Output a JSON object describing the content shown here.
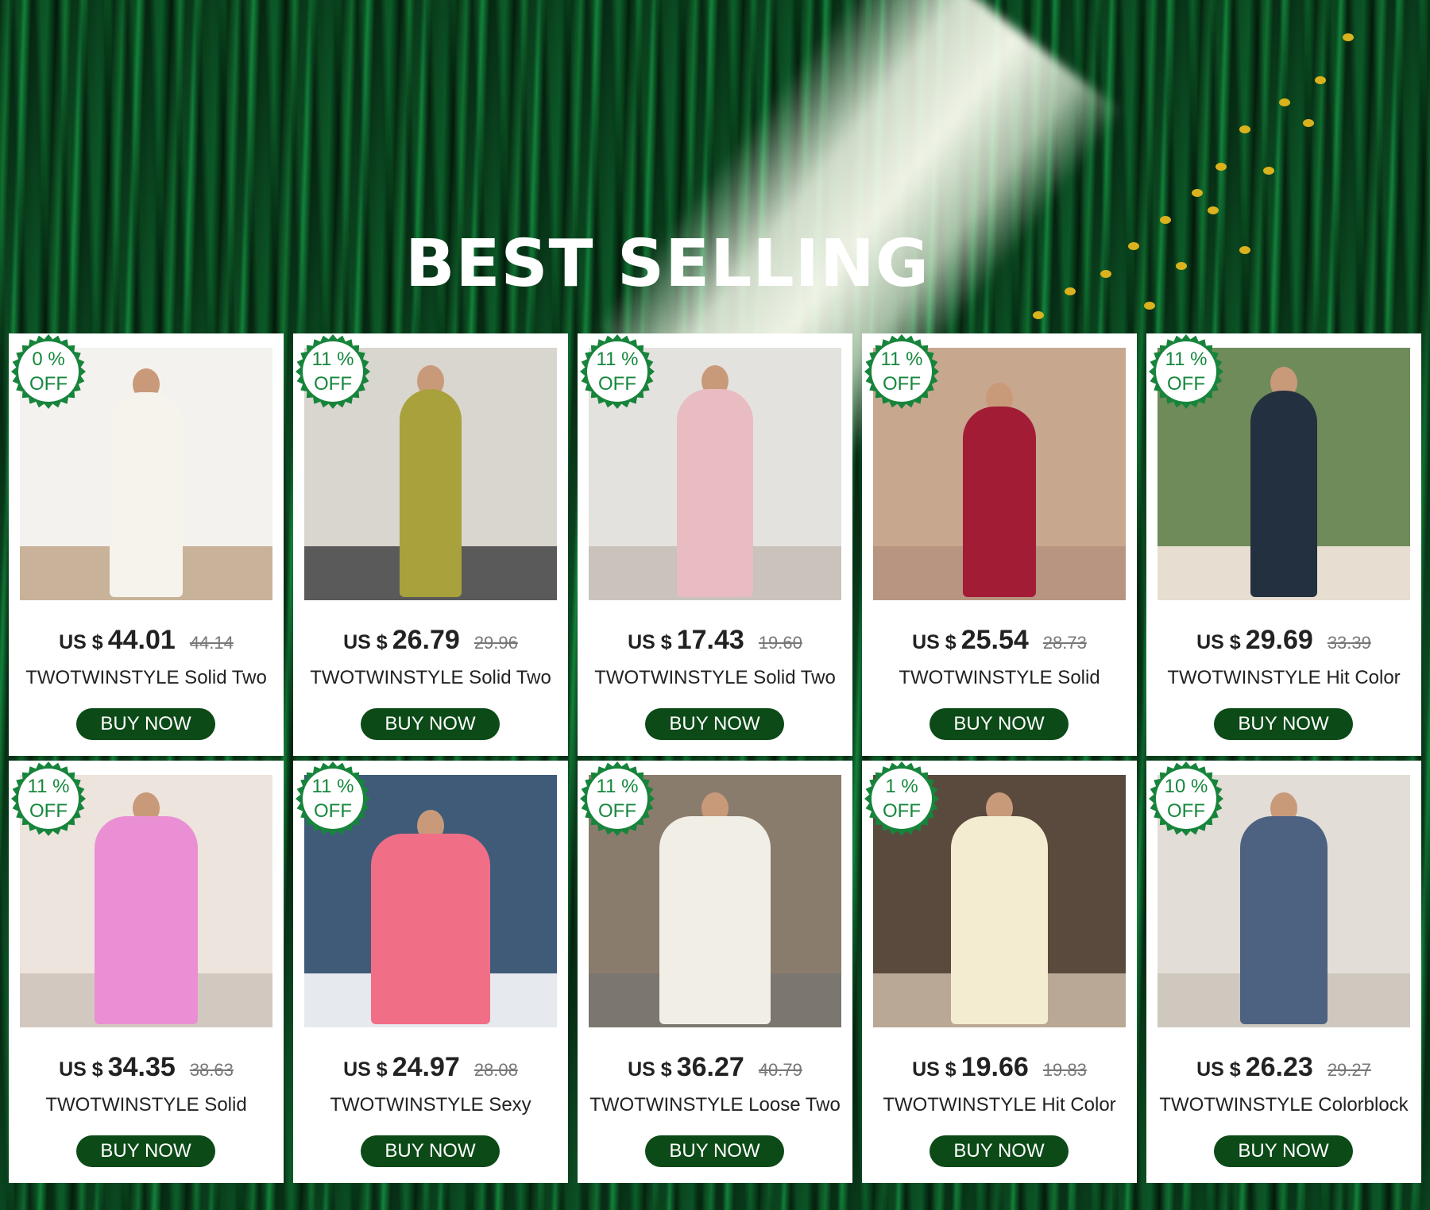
{
  "banner": {
    "title": "BEST SELLING"
  },
  "product_labels": {
    "currency": "US $",
    "off": "OFF",
    "buy": "BUY NOW"
  },
  "products": [
    {
      "discount": "0 %",
      "price": "44.01",
      "old_price": "44.14",
      "name": "TWOTWINSTYLE Solid Two",
      "bg": "#f4f2ee",
      "floor": "#c8b39a",
      "outfit": "#f6f3ec",
      "fig_w": 92,
      "fig_h": 258
    },
    {
      "discount": "11 %",
      "price": "26.79",
      "old_price": "29.96",
      "name": "TWOTWINSTYLE Solid Two",
      "bg": "#d9d5cf",
      "floor": "#5a5a5a",
      "outfit": "#a8a13c",
      "fig_w": 78,
      "fig_h": 262
    },
    {
      "discount": "11 %",
      "price": "17.43",
      "old_price": "19.60",
      "name": "TWOTWINSTYLE Solid Two",
      "bg": "#e4e2df",
      "floor": "#c9c3bc",
      "outfit": "#e8bcc0",
      "fig_w": 96,
      "fig_h": 262
    },
    {
      "discount": "11 %",
      "price": "25.54",
      "old_price": "28.73",
      "name": "TWOTWINSTYLE Solid",
      "bg": "#c8a78f",
      "floor": "#b89580",
      "outfit": "#a31c36",
      "fig_w": 92,
      "fig_h": 240
    },
    {
      "discount": "11 %",
      "price": "29.69",
      "old_price": "33.39",
      "name": "TWOTWINSTYLE Hit Color",
      "bg": "#6f8b5a",
      "floor": "#e7ddd0",
      "outfit": "#233040",
      "fig_w": 84,
      "fig_h": 260
    },
    {
      "discount": "11 %",
      "price": "34.35",
      "old_price": "38.63",
      "name": "TWOTWINSTYLE Solid",
      "bg": "#ece4dd",
      "floor": "#d3c8bf",
      "outfit": "#ea8fd3",
      "fig_w": 130,
      "fig_h": 262
    },
    {
      "discount": "11 %",
      "price": "24.97",
      "old_price": "28.08",
      "name": "TWOTWINSTYLE Sexy",
      "bg": "#3f5b78",
      "floor": "#e6e9ee",
      "outfit": "#f06f86",
      "fig_w": 150,
      "fig_h": 240
    },
    {
      "discount": "11 %",
      "price": "36.27",
      "old_price": "40.79",
      "name": "TWOTWINSTYLE Loose Two",
      "bg": "#8a7c6c",
      "floor": "#7b7770",
      "outfit": "#f1eee6",
      "fig_w": 140,
      "fig_h": 262
    },
    {
      "discount": "1 %",
      "price": "19.66",
      "old_price": "19.83",
      "name": "TWOTWINSTYLE Hit Color",
      "bg": "#5a4a3e",
      "floor": "#b9a896",
      "outfit": "#f3ecd0",
      "fig_w": 122,
      "fig_h": 262
    },
    {
      "discount": "10 %",
      "price": "26.23",
      "old_price": "29.27",
      "name": "TWOTWINSTYLE Colorblock",
      "bg": "#e2ddd6",
      "floor": "#cfc8bf",
      "outfit": "#4d6281",
      "fig_w": 110,
      "fig_h": 262
    }
  ]
}
